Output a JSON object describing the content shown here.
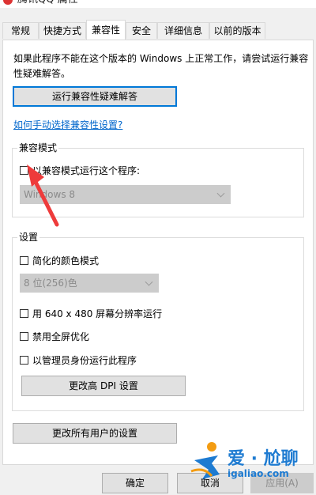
{
  "window": {
    "title": "腾讯QQ 属性"
  },
  "tabs": [
    {
      "label": "常规"
    },
    {
      "label": "快捷方式"
    },
    {
      "label": "兼容性"
    },
    {
      "label": "安全"
    },
    {
      "label": "详细信息"
    },
    {
      "label": "以前的版本"
    }
  ],
  "active_tab": "兼容性",
  "intro_text": "如果此程序不能在这个版本的 Windows 上正常工作，请尝试运行兼容性疑难解答。",
  "troubleshoot_button": "运行兼容性疑难解答",
  "manual_link": "如何手动选择兼容性设置?",
  "compat_mode": {
    "group_label": "兼容模式",
    "checkbox_label": "以兼容模式运行这个程序:",
    "checked": false,
    "select_value": "Windows 8"
  },
  "settings": {
    "group_label": "设置",
    "reduced_color": {
      "label": "简化的颜色模式",
      "checked": false
    },
    "color_select_value": "8 位(256)色",
    "run_640": {
      "label": "用 640 x 480 屏幕分辨率运行",
      "checked": false
    },
    "disable_fullscreen": {
      "label": "禁用全屏优化",
      "checked": false
    },
    "run_as_admin": {
      "label": "以管理员身份运行此程序",
      "checked": false
    },
    "dpi_button": "更改高 DPI 设置"
  },
  "all_users_button": "更改所有用户的设置",
  "footer": {
    "ok": "确定",
    "cancel": "取消",
    "apply": "应用(A)"
  },
  "watermark": {
    "cn": "爱 · 尬聊",
    "en": "igaliao.com"
  },
  "colors": {
    "link": "#0066cc",
    "accent": "#0078d7",
    "arrow": "#ee3b3b",
    "watermark": "#1e7bd1"
  }
}
